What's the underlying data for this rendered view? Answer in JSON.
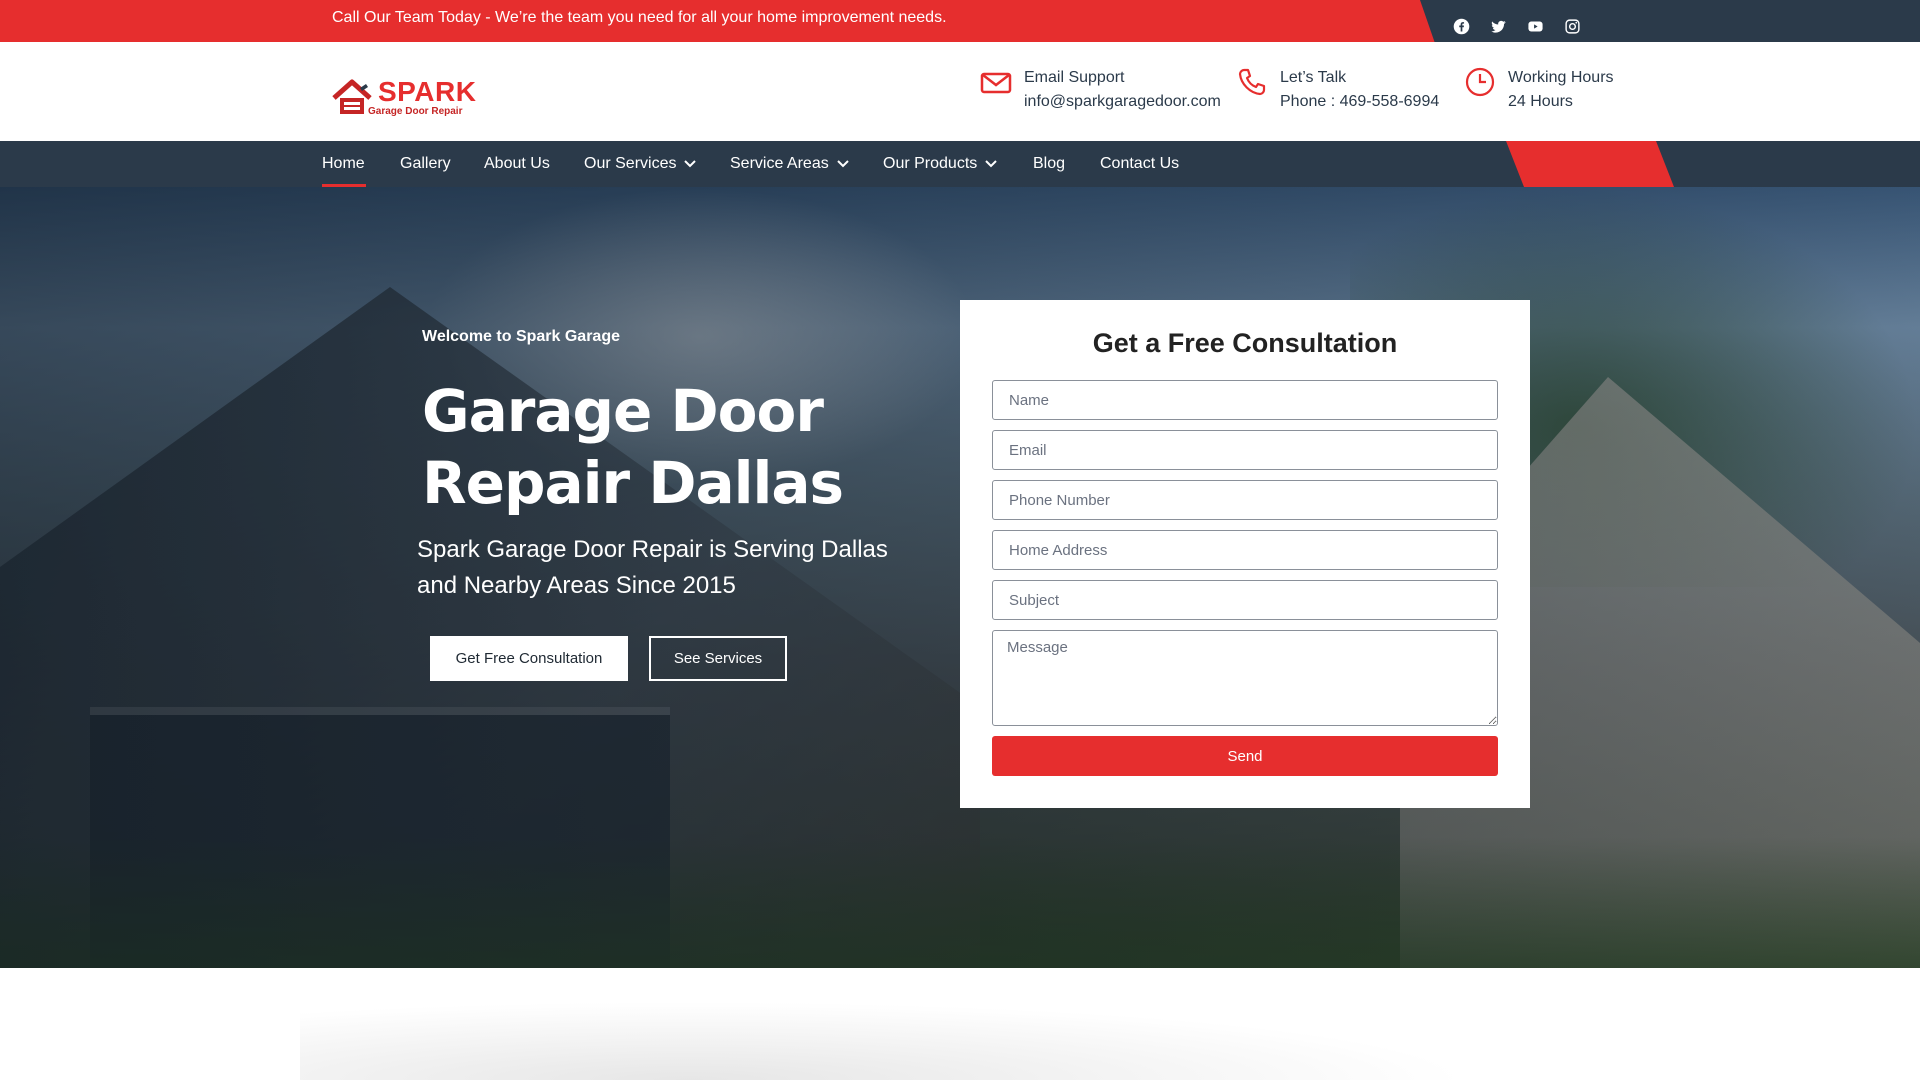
{
  "topbar": {
    "message": "Call Our Team Today - We’re the team you need for all your home improvement needs.",
    "social": [
      "facebook-icon",
      "twitter-icon",
      "youtube-icon",
      "instagram-icon"
    ]
  },
  "logo": {
    "word": "SPARK",
    "tagline": "Garage Door Repair"
  },
  "contact": {
    "email_title": "Email Support",
    "email_value": "info@sparkgaragedoor.com",
    "phone_title": "Let’s Talk",
    "phone_value": "Phone : 469-558-6994",
    "hours_title": "Working Hours",
    "hours_value": "24 Hours"
  },
  "nav": {
    "items": [
      {
        "label": "Home",
        "active": true
      },
      {
        "label": "Gallery"
      },
      {
        "label": "About Us"
      },
      {
        "label": "Our Services",
        "dropdown": true
      },
      {
        "label": "Service Areas",
        "dropdown": true
      },
      {
        "label": "Our Products",
        "dropdown": true
      },
      {
        "label": "Blog"
      },
      {
        "label": "Contact Us"
      }
    ]
  },
  "hero": {
    "welcome": "Welcome to Spark Garage",
    "title": "Garage Door Repair Dallas",
    "subtitle": "Spark Garage Door Repair is Serving Dallas and Nearby Areas Since 2015",
    "cta_primary": "Get Free Consultation",
    "cta_secondary": "See Services"
  },
  "form": {
    "title": "Get a Free Consultation",
    "name_placeholder": "Name",
    "email_placeholder": "Email",
    "phone_placeholder": "Phone Number",
    "address_placeholder": "Home Address",
    "subject_placeholder": "Subject",
    "message_placeholder": "Message",
    "submit_label": "Send"
  },
  "colors": {
    "accent": "#e62e2e",
    "navy": "#2b3a4a"
  }
}
